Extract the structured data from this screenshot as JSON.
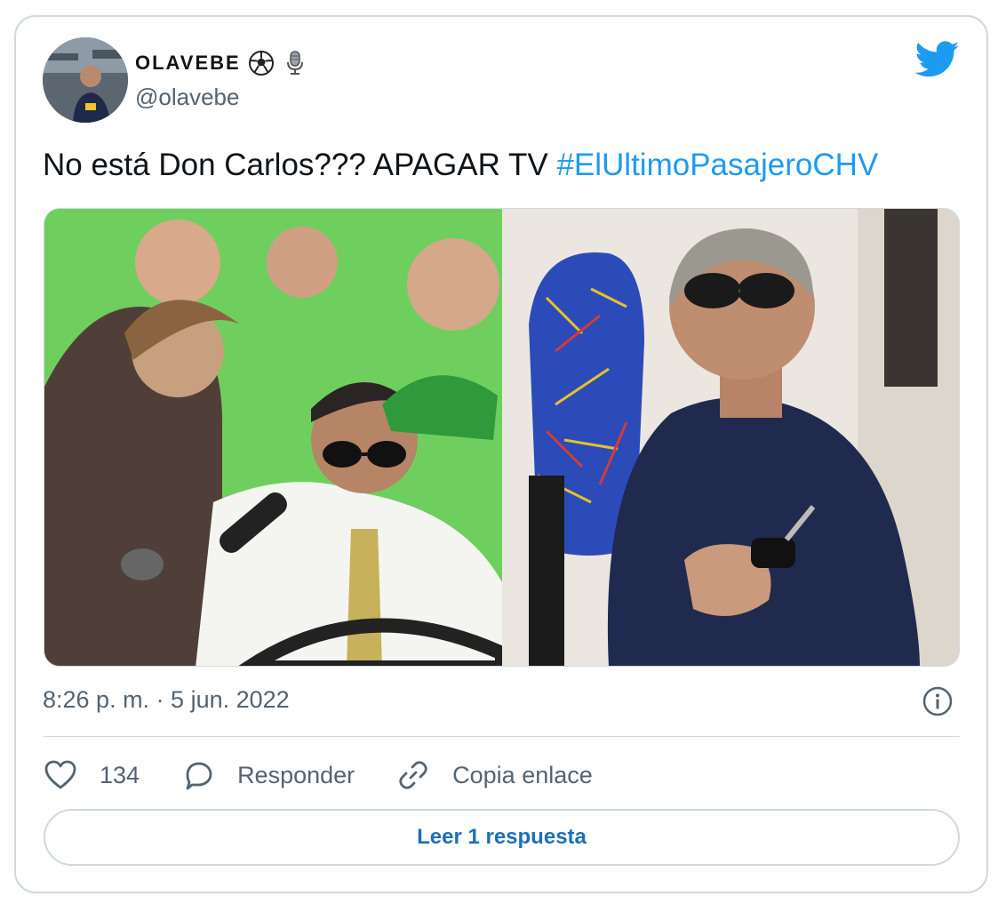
{
  "author": {
    "display_name": "OLAVEBE",
    "handle": "@olavebe",
    "badges": [
      "soccer-ball-icon",
      "microphone-icon"
    ]
  },
  "brand": {
    "icon": "twitter-bird-icon",
    "color": "#1d9bf0"
  },
  "tweet": {
    "text": "No está Don Carlos??? APAGAR TV ",
    "hashtag": "#ElUltimoPasajeroCHV",
    "timestamp": "8:26 p. m. · 5 jun. 2022"
  },
  "media": {
    "images": [
      {
        "name": "tv-show-photo",
        "alt": ""
      },
      {
        "name": "bus-driver-photo",
        "alt": ""
      }
    ]
  },
  "actions": {
    "likes": "134",
    "reply_label": "Responder",
    "copy_link_label": "Copia enlace"
  },
  "read_replies": "Leer 1 respuesta",
  "colors": {
    "text": "#0f1419",
    "muted": "#536471",
    "link": "#1d9bf0",
    "border": "#cfd9de"
  }
}
